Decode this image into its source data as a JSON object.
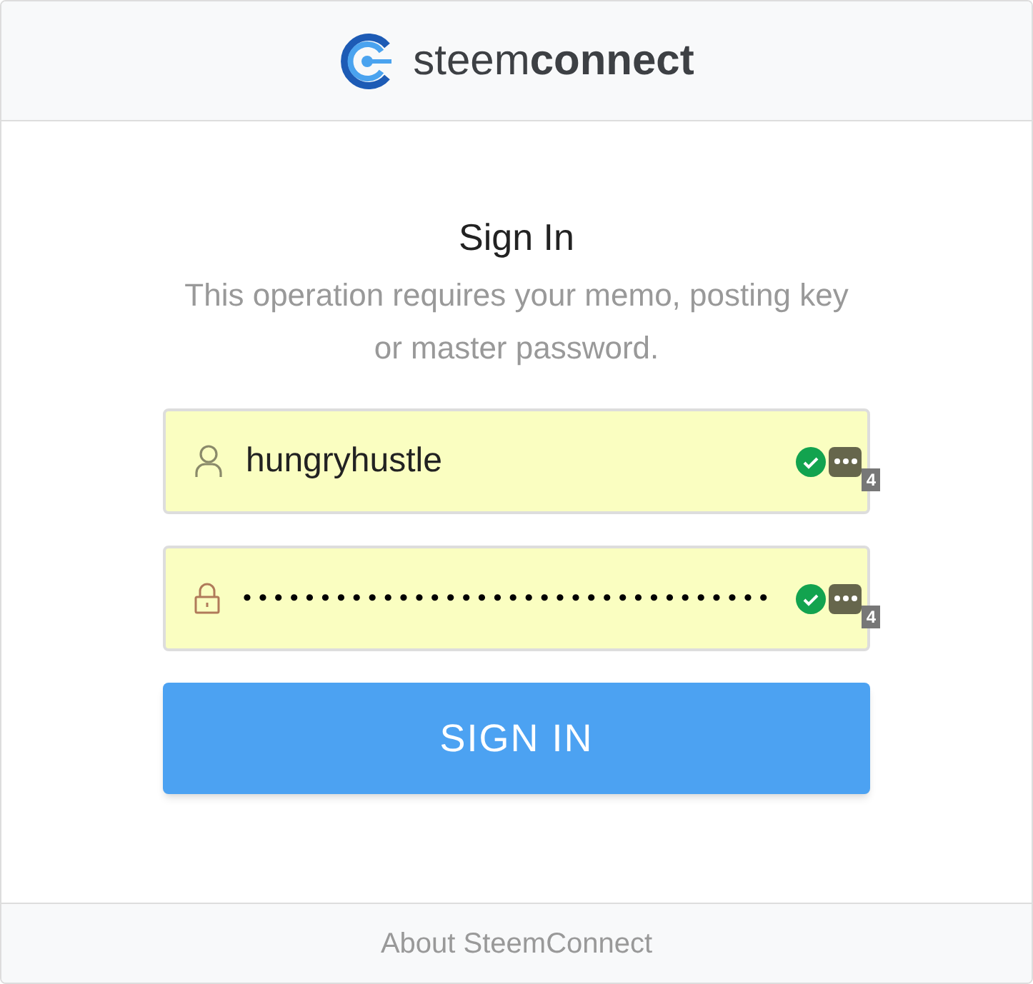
{
  "header": {
    "logo_text": "steem**connect**"
  },
  "form": {
    "title": "Sign In",
    "subtitle": "This operation requires your memo, posting key or master password.",
    "fields": [
      {
        "kind": "username",
        "value": "hungryhustle",
        "valid": true,
        "manager_badge": "4"
      },
      {
        "kind": "password",
        "value": "••••••••••••••••••••••••••••••••••",
        "valid": true,
        "manager_badge": "4"
      }
    ],
    "submit": "SIGN IN"
  },
  "footer": {
    "link": "About SteemConnect"
  }
}
